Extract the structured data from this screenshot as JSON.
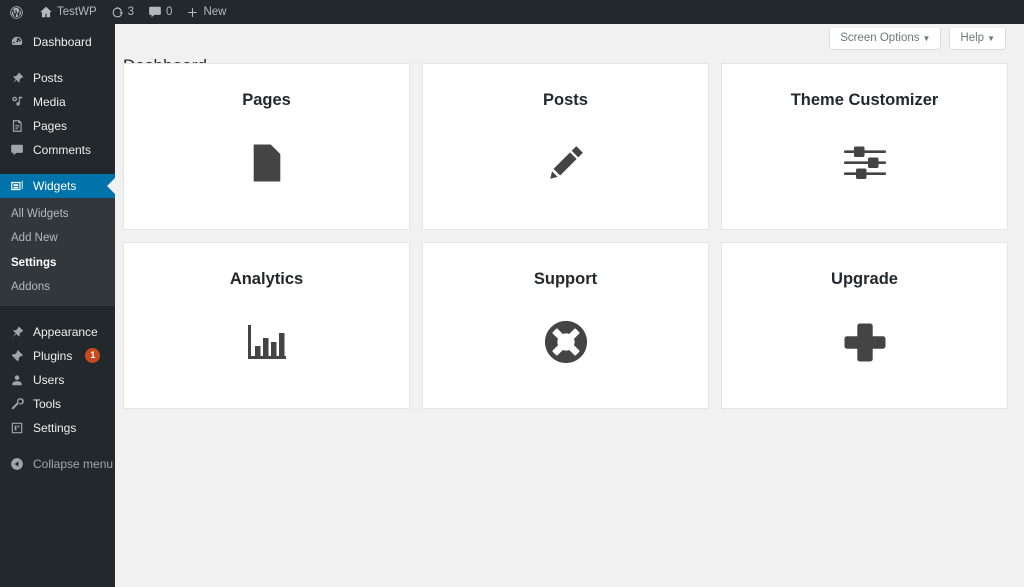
{
  "adminbar": {
    "items": [
      {
        "icon": "wordpress-logo-icon",
        "label": ""
      },
      {
        "icon": "home-icon",
        "label": "TestWP"
      },
      {
        "icon": "updates-icon",
        "label": "3"
      },
      {
        "icon": "comments-icon",
        "label": "0"
      },
      {
        "icon": "plus-icon",
        "label": "New"
      }
    ]
  },
  "sidebar": {
    "items": [
      {
        "label": "Dashboard",
        "icon": "dashboard-icon"
      },
      {
        "label": "Posts",
        "icon": "pin-icon"
      },
      {
        "label": "Media",
        "icon": "media-icon"
      },
      {
        "label": "Pages",
        "icon": "page-icon"
      },
      {
        "label": "Comments",
        "icon": "comment-icon"
      },
      {
        "label": "Widgets",
        "icon": "widgets-icon"
      },
      {
        "label": "Appearance",
        "icon": "appearance-icon"
      },
      {
        "label": "Plugins",
        "icon": "plugins-icon",
        "badge": "1"
      },
      {
        "label": "Users",
        "icon": "users-icon"
      },
      {
        "label": "Tools",
        "icon": "tools-icon"
      },
      {
        "label": "Settings",
        "icon": "settings-icon"
      },
      {
        "label": "Collapse menu",
        "icon": "collapse-icon"
      }
    ],
    "submenu": [
      {
        "label": "All Widgets"
      },
      {
        "label": "Add New"
      },
      {
        "label": "Settings"
      },
      {
        "label": "Addons"
      }
    ],
    "current_item": "Widgets",
    "current_subitem": "Settings",
    "highlight_color": "#0073aa",
    "badge_color": "#ca4a1f"
  },
  "screen_meta": {
    "screen_options": "Screen Options",
    "help": "Help",
    "caret": "▼"
  },
  "header": {
    "title": "Dashboard"
  },
  "cards": [
    {
      "title": "Pages",
      "icon": "document-icon"
    },
    {
      "title": "Posts",
      "icon": "pencil-icon"
    },
    {
      "title": "Theme Customizer",
      "icon": "sliders-icon"
    },
    {
      "title": "Analytics",
      "icon": "bar-chart-icon"
    },
    {
      "title": "Support",
      "icon": "lifebuoy-icon"
    },
    {
      "title": "Upgrade",
      "icon": "plus-thick-icon"
    }
  ]
}
